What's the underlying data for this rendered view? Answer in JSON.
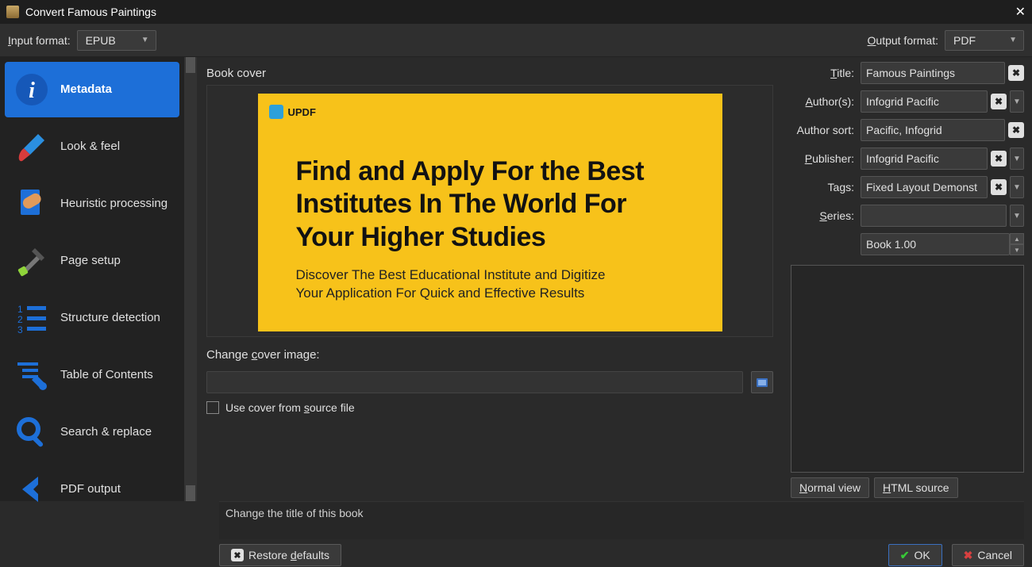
{
  "titlebar": {
    "title": "Convert Famous Paintings"
  },
  "formats": {
    "input_label": "Input format:",
    "input_value": "EPUB",
    "output_label": "Output format:",
    "output_value": "PDF"
  },
  "sidebar": {
    "items": [
      {
        "label": "Metadata"
      },
      {
        "label": "Look & feel"
      },
      {
        "label": "Heuristic processing"
      },
      {
        "label": "Page setup"
      },
      {
        "label": "Structure detection"
      },
      {
        "label": "Table of Contents"
      },
      {
        "label": "Search & replace"
      },
      {
        "label": "PDF output"
      }
    ]
  },
  "cover": {
    "section_label": "Book cover",
    "brand": "UPDF",
    "headline": "Find and Apply For the Best Institutes In The World For Your Higher Studies",
    "subhead": "Discover The Best Educational Institute and Digitize Your Application For Quick and Effective Results",
    "change_label": "Change cover image:",
    "path": "",
    "use_source_label": "Use cover from source file"
  },
  "fields": {
    "title_label": "Title:",
    "title": "Famous Paintings",
    "authors_label": "Author(s):",
    "authors": "Infogrid Pacific",
    "authorsort_label": "Author sort:",
    "authorsort": "Pacific, Infogrid",
    "publisher_label": "Publisher:",
    "publisher": "Infogrid Pacific",
    "tags_label": "Tags:",
    "tags": "Fixed Layout Demonstration",
    "series_label": "Series:",
    "series": "",
    "book_index": "Book 1.00"
  },
  "tabs": {
    "normal": "Normal view",
    "html": "HTML source"
  },
  "hint": "Change the title of this book",
  "buttons": {
    "restore": "Restore defaults",
    "ok": "OK",
    "cancel": "Cancel"
  }
}
